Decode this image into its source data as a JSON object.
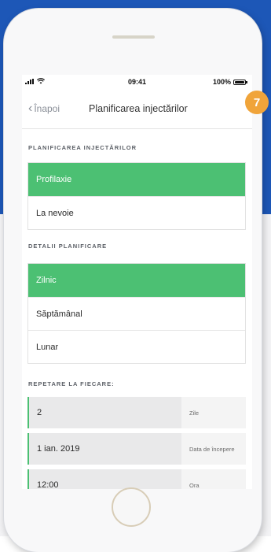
{
  "status_bar": {
    "time": "09:41",
    "battery": "100%",
    "battery_level": 1.0
  },
  "nav": {
    "back_label": "Înapoi",
    "back_icon": "chevron-left-icon",
    "title": "Planificarea injectărilor"
  },
  "sections": {
    "plan": {
      "label": "PLANIFICAREA INJECTĂRILOR",
      "options": [
        "Profilaxie",
        "La nevoie"
      ],
      "selected": "Profilaxie"
    },
    "details": {
      "label": "DETALII PLANIFICARE",
      "options": [
        "Zilnic",
        "Săptămânal",
        "Lunar"
      ],
      "selected": "Zilnic"
    },
    "repeat": {
      "label": "REPETARE LA FIECARE:",
      "rows": [
        {
          "value": "2",
          "unit": "Zile"
        },
        {
          "value": "1 ian. 2019",
          "unit": "Data de începere"
        },
        {
          "value": "12:00",
          "unit": "Ora"
        }
      ]
    }
  },
  "step_badge": "7",
  "colors": {
    "accent_green": "#4cc073",
    "badge_orange": "#f0a43a",
    "background_blue": "#1d57b7"
  }
}
